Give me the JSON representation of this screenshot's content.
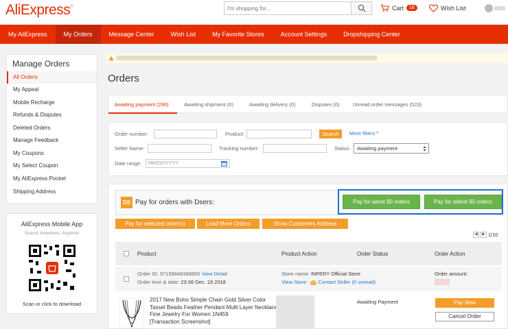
{
  "header": {
    "logo": "AliExpress",
    "logo_mark": "®",
    "search_placeholder": "I'm shopping for...",
    "cart_label": "Cart",
    "cart_count": "18",
    "wishlist_label": "Wish List"
  },
  "nav": {
    "items": [
      {
        "label": "My AliExpress"
      },
      {
        "label": "My Orders"
      },
      {
        "label": "Message Center"
      },
      {
        "label": "Wish List"
      },
      {
        "label": "My Favorite Stores"
      },
      {
        "label": "Account Settings"
      },
      {
        "label": "Dropshipping Center"
      }
    ],
    "active": "My Orders"
  },
  "sidebar": {
    "title": "Manage Orders",
    "items": [
      {
        "label": "All Orders"
      },
      {
        "label": "My Appeal"
      },
      {
        "label": "Mobile Recharge"
      },
      {
        "label": "Refunds & Disputes"
      },
      {
        "label": "Deleted Orders"
      },
      {
        "label": "Manage Feedback"
      },
      {
        "label": "My Coupons"
      },
      {
        "label": "My Select Coupon"
      },
      {
        "label": "My AliExpress Pocket"
      },
      {
        "label": "Shipping Address"
      }
    ],
    "active": "All Orders"
  },
  "mobile_app": {
    "title": "AliExpress Mobile App",
    "subtitle": "Search Anywhere, Anytime!",
    "caption": "Scan or click to download"
  },
  "main": {
    "title": "Orders",
    "tabs": [
      {
        "label": "Awaiting payment (290)"
      },
      {
        "label": "Awaiting shipment (0)"
      },
      {
        "label": "Awaiting delivery (0)"
      },
      {
        "label": "Disputes (0)"
      },
      {
        "label": "Unread order messages (523)"
      }
    ],
    "filters": {
      "order_number_label": "Order number:",
      "product_label": "Product:",
      "search_button": "Search",
      "more_filters": "More filters ^",
      "seller_name_label": "Seller Name:",
      "tracking_number_label": "Tracking number:",
      "status_label": "Status:",
      "status_value": "Awaiting payment",
      "date_range_label": "Date range:",
      "date_placeholder": "MM/DD/YYYY"
    },
    "dsers": {
      "logo": "DS",
      "text": "Pay for orders with Dsers:",
      "btn_latest": "Pay for latest 90 orders",
      "btn_oldest": "Pay for oldest 90 orders"
    },
    "actions": {
      "pay_selected": "Pay for selected order(s)",
      "load_more": "Load More Orders",
      "show_address": "Show Customers Address"
    },
    "pager": {
      "text": "1/10"
    },
    "table": {
      "headers": [
        "Product",
        "Product Action",
        "Order Status",
        "Order Action"
      ]
    },
    "order": {
      "id_label": "Order ID:",
      "id_value": "97159848368800",
      "view_detail": "View Detail",
      "time_label": "Order time & date:",
      "time_value": "23:36 Dec. 19 2018",
      "store_label": "Store name:",
      "store_value": "INFERY Official Store",
      "view_store": "View Store",
      "contact_seller": "Contact Seller (0 unread)",
      "amount_label": "Order amount:",
      "product_title": "2017 New Boho Simple Chain Gold Silver Color Tassel Beads Feather Pendant Multi Layer Necklace Fine Jewelry For Women 1N459",
      "snapshot": "[Transaction Screenshot]",
      "status": "Awaiting Payment",
      "pay_now": "Pay Now",
      "cancel": "Cancel Order"
    }
  },
  "colors": {
    "brand": "#e62e04",
    "orange": "#f39c2a",
    "green": "#6ab44c",
    "link": "#2a74c2",
    "highlight": "#1e73d4"
  }
}
